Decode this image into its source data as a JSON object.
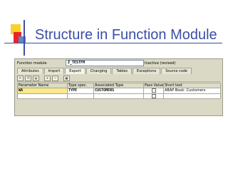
{
  "slide": {
    "title": "Structure in Function Module"
  },
  "header": {
    "label": "Function module",
    "value": "Z_TESTFM",
    "status": "Inactive (revised)"
  },
  "tabs": [
    {
      "label": "Attributes",
      "active": false
    },
    {
      "label": "Import",
      "active": false
    },
    {
      "label": "Export",
      "active": true
    },
    {
      "label": "Changing",
      "active": false
    },
    {
      "label": "Tables",
      "active": false
    },
    {
      "label": "Exceptions",
      "active": false
    },
    {
      "label": "Source code",
      "active": false
    }
  ],
  "grid": {
    "columns": [
      "Parameter Name",
      "Type spec.",
      "Associated Type",
      "Pass Value",
      "Short text"
    ],
    "rows": [
      [
        "WA",
        "TYPE",
        "CUSTOMERS",
        "",
        "ABAP Book: Customers"
      ],
      [
        "",
        "",
        "",
        "",
        ""
      ]
    ]
  }
}
